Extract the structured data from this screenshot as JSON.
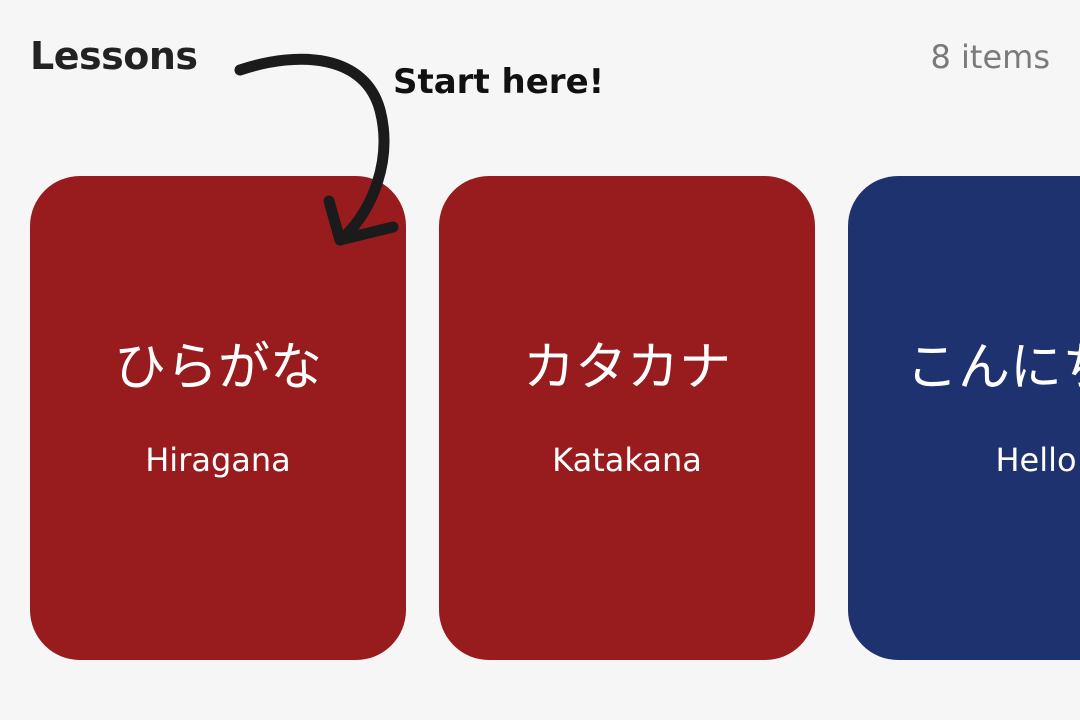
{
  "header": {
    "title": "Lessons",
    "count": "8 items"
  },
  "annotation": {
    "text": "Start here!"
  },
  "lessons": [
    {
      "japanese": "ひらがな",
      "english": "Hiragana",
      "color": "#981c1e"
    },
    {
      "japanese": "カタカナ",
      "english": "Katakana",
      "color": "#981c1e"
    },
    {
      "japanese": "こんにちは",
      "english": "Hello",
      "color": "#1f3270"
    }
  ]
}
